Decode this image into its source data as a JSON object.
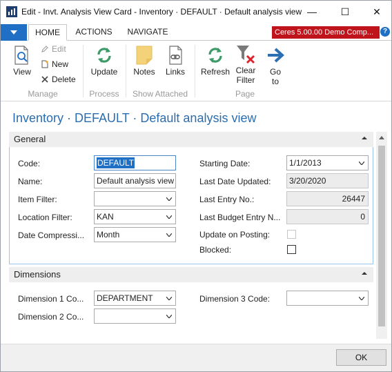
{
  "window": {
    "title": "Edit - Invt. Analysis View Card - Inventory · DEFAULT · Default analysis view",
    "minimize_glyph": "—",
    "maximize_glyph": "☐",
    "close_glyph": "✕"
  },
  "ribbon": {
    "tabs": [
      {
        "label": "HOME",
        "active": true
      },
      {
        "label": "ACTIONS",
        "active": false
      },
      {
        "label": "NAVIGATE",
        "active": false
      }
    ],
    "company": "Ceres 5.00.00 Demo Comp...",
    "help_glyph": "?",
    "groups": [
      {
        "label": "Manage",
        "actions": [
          "View",
          "Edit",
          "New",
          "Delete"
        ]
      },
      {
        "label": "Process",
        "actions": [
          "Update"
        ]
      },
      {
        "label": "Show Attached",
        "actions": [
          "Notes",
          "Links"
        ]
      },
      {
        "label": "Page",
        "actions": [
          "Refresh",
          "Clear Filter",
          "Go to"
        ]
      }
    ],
    "view": "View",
    "edit": "Edit",
    "new": "New",
    "delete": "Delete",
    "update": "Update",
    "notes": "Notes",
    "links": "Links",
    "refresh": "Refresh",
    "clear_filter_1": "Clear",
    "clear_filter_2": "Filter",
    "go_to_1": "Go",
    "go_to_2": "to",
    "group_manage": "Manage",
    "group_process": "Process",
    "group_show_attached": "Show Attached",
    "group_page": "Page"
  },
  "page_title": "Inventory · DEFAULT · Default analysis view",
  "general": {
    "title": "General",
    "fields": {
      "code": {
        "label": "Code:",
        "value": "DEFAULT"
      },
      "name": {
        "label": "Name:",
        "value": "Default analysis view"
      },
      "item_filter": {
        "label": "Item Filter:",
        "value": ""
      },
      "location_filter": {
        "label": "Location Filter:",
        "value": "KAN"
      },
      "date_compression": {
        "label": "Date Compressi...",
        "value": "Month"
      },
      "starting_date": {
        "label": "Starting Date:",
        "value": "1/1/2013"
      },
      "last_date_updated": {
        "label": "Last Date Updated:",
        "value": "3/20/2020"
      },
      "last_entry_no": {
        "label": "Last Entry No.:",
        "value": "26447"
      },
      "last_budget_entry_no": {
        "label": "Last Budget Entry N...",
        "value": "0"
      },
      "update_on_posting": {
        "label": "Update on Posting:",
        "checked": false
      },
      "blocked": {
        "label": "Blocked:",
        "checked": false
      }
    }
  },
  "dimensions": {
    "title": "Dimensions",
    "fields": {
      "dimension_1_code": {
        "label": "Dimension 1 Co...",
        "value": "DEPARTMENT"
      },
      "dimension_2_code": {
        "label": "Dimension 2 Co...",
        "value": ""
      },
      "dimension_3_code": {
        "label": "Dimension 3 Code:",
        "value": ""
      }
    }
  },
  "footer": {
    "ok_label": "OK"
  },
  "colors": {
    "accent": "#1f6fc5",
    "title_blue": "#2a6db0",
    "company_badge": "#c0141c",
    "refresh_green": "#3f9a6a",
    "clear_filter_red": "#d9262c",
    "notes_yellow": "#f4d27a"
  }
}
